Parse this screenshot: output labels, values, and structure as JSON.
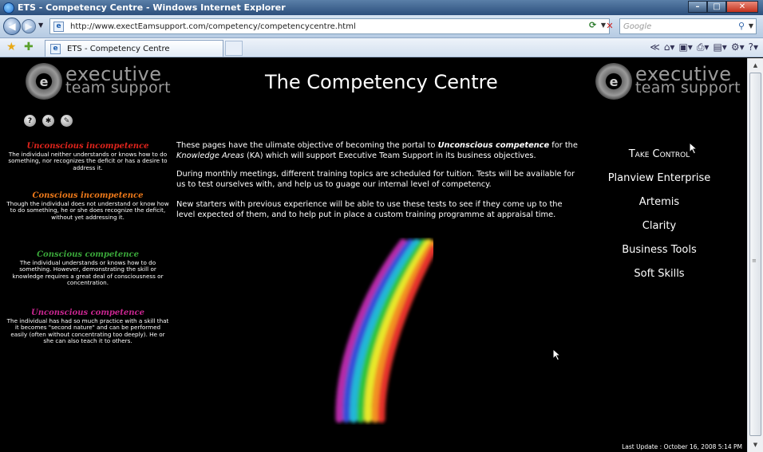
{
  "window": {
    "title": "ETS - Competency Centre - Windows Internet Explorer",
    "controls": [
      "–",
      "□",
      "✕"
    ]
  },
  "address_bar": {
    "url": "http://www.exectEamsupport.com/competency/competencycentre.html",
    "search_placeholder": "Google"
  },
  "tab": {
    "label": "ETS - Competency Centre"
  },
  "page": {
    "title": "The Competency Centre",
    "logo": {
      "line1": "executive",
      "line2": "team support"
    },
    "help_icons": [
      "help-icon",
      "settings-icon",
      "edit-icon"
    ],
    "stages": [
      {
        "title": "Unconscious incompetence",
        "color": "#e0241c",
        "text": "The individual neither understands or knows how to do something, nor recognizes the deficit or has a desire to address it."
      },
      {
        "title": "Conscious incompetence",
        "color": "#ef7a1a",
        "text": "Though the individual does not understand or know how to do something, he or she does recognize the deficit, without yet addressing it."
      },
      {
        "title": "Conscious competence",
        "color": "#3aa83a",
        "text": "The individual understands or knows how to do something. However, demonstrating the skill or knowledge requires a great deal of consciousness or concentration."
      },
      {
        "title": "Unconscious competence",
        "color": "#c8258f",
        "text": "The individual has had so much practice with a skill that it becomes \"second nature\" and can be performed easily (often without concentrating too deeply). He or she can also teach it to others."
      }
    ],
    "intro": {
      "p1_a": "These pages have the ulimate objective of becoming the portal to ",
      "p1_b": "Unconscious competence",
      "p1_c": " for the ",
      "p1_d": "Knowledge Areas",
      "p1_e": " (KA) which will support Executive Team Support in its business objectives.",
      "p2": "During monthly meetings, different training topics are scheduled for tuition. Tests will be available for us to test ourselves with, and help us to guage our internal level of competency.",
      "p3": "New starters with previous experience will be able to use these tests to see if they come up to the level expected of them, and to help put in place a custom training programme at appraisal time."
    },
    "nav_links": [
      "Take Control",
      "Planview Enterprise",
      "Artemis",
      "Clarity",
      "Business Tools",
      "Soft Skills"
    ],
    "footer": "Last Update : October 16, 2008 5:14 PM"
  }
}
